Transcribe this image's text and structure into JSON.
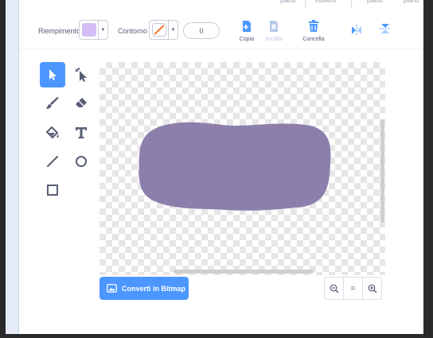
{
  "top_tabs": [
    "piano",
    "indietro",
    "piano",
    "piano"
  ],
  "toolbar": {
    "fill_label": "Riempimento",
    "outline_label": "Contorno",
    "stroke_width": "0",
    "copy_label": "Copia",
    "paste_label": "Incolla",
    "delete_label": "Cancella"
  },
  "colors": {
    "accent": "#4c97ff",
    "fill_color": "#d4bcf5",
    "shape_fill": "#8d7fac",
    "delete_icon": "#4c97ff"
  },
  "tools": [
    {
      "name": "select",
      "icon": "arrow-select-icon",
      "active": true
    },
    {
      "name": "reshape",
      "icon": "reshape-icon",
      "active": false
    },
    {
      "name": "brush",
      "icon": "brush-icon",
      "active": false
    },
    {
      "name": "eraser",
      "icon": "eraser-icon",
      "active": false
    },
    {
      "name": "fill",
      "icon": "paint-bucket-icon",
      "active": false
    },
    {
      "name": "text",
      "icon": "text-icon",
      "active": false
    },
    {
      "name": "line",
      "icon": "line-icon",
      "active": false
    },
    {
      "name": "circle",
      "icon": "circle-icon",
      "active": false
    },
    {
      "name": "rectangle",
      "icon": "rectangle-icon",
      "active": false
    }
  ],
  "canvas": {
    "convert_button_label": "Converti in Bitmap"
  },
  "zoom": {
    "zoom_out": "−",
    "reset": "=",
    "zoom_in": "+"
  }
}
